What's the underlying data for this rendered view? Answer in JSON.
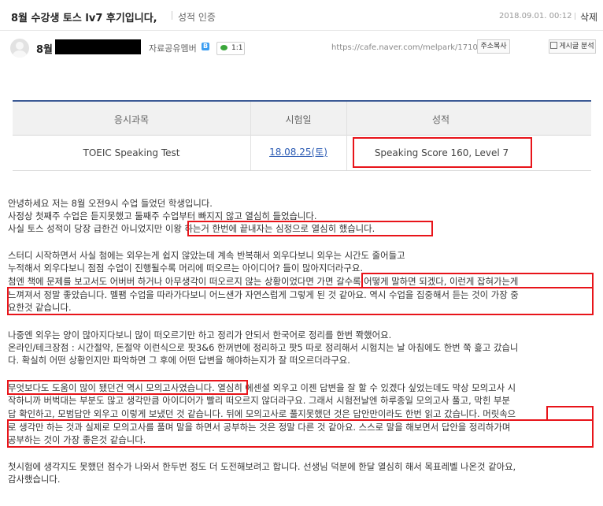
{
  "post": {
    "title": "8월 수강생 토스 lv7 후기입니다,",
    "category": "성적 인증",
    "date": "2018.09.01. 00:12",
    "delete_label": "삭제"
  },
  "author": {
    "name": "8월",
    "level": "자료공유멤버",
    "level_icon": "B",
    "talk_count": "1:1",
    "url": "https://cafe.naver.com/melpark/17109",
    "copy_button": "주소복사",
    "view_button": "게시글 분석"
  },
  "table": {
    "headers": [
      "응시과목",
      "시험일",
      "성적"
    ],
    "row": [
      "TOEIC Speaking Test",
      "18.08.25(토)",
      "Speaking Score 160, Level 7"
    ]
  },
  "body": {
    "lines": [
      "안녕하세요 저는 8월 오전9시 수업 들었던 학생입니다.",
      "사정상 첫째주 수업은 듣지못했고 둘째주 수업부터 빠지지 않고 열심히 들었습니다.",
      "사실 토스 성적이 당장 급한건 아니었지만 이왕 하는거 한번에 끝내자는 심정으로 열심히 했습니다.",
      "스터디 시작하면서 사실 첨에는 외우는게 쉽지 않았는데 계속 반복해서 외우다보니 외우는 시간도 줄어들고",
      "누적해서 외우다보니 점점 수업이 진행될수록 머리에 떠오르는 아이디어? 들이 많아지더라구요.",
      "첨엔 책에 문제를 보고서도 어버버 하거나 아무생각이 떠오르지 않는 상황이었다면 가면 갈수록 어떻게 말하면 되겠다, 이런게 잡혀가는게",
      "느껴져서 정말 좋았습니다. 멜팸 수업을 따라가다보니 어느샌가 자연스럽게 그렇게 된 것 같아요. 역시 수업을 집중해서 듣는 것이 가장 중",
      "요한것 같습니다.",
      "나중엔 외우는 양이 많아지다보니 많이 떠오르기만 하고 정리가 안되서 한국어로 정리를 한번 쫙했어요.",
      "온라인/테크장점 : 시간절약, 돈절약 이런식으로 팟3&6 한꺼번에 정리하고 팟5 따로 정리해서 시험치는 날 아침에도 한번 쭉 흝고 갔습니",
      "다. 확실히 어떤 상황인지만 파악하면 그 후에 어떤 답변을 해야하는지가 잘 떠오르더라구요.",
      "무엇보다도 도움이 많이 됐던건 역시 모의고사였습니다. 열심히 에센셜 외우고 이젠 답변을 잘 할 수 있겠다 싶었는데도 막상 모의고사 시",
      "작하니까 버벅대는 부분도 많고 생각만큼 아이디어가 빨리 떠오르지 않더라구요. 그래서 시험전날엔 하루종일 모의고사 풀고, 막힌 부분",
      "답 확인하고, 모범답안 외우고 이렇게 보냈던 것 같습니다. 뒤에 모의고사로 풀지못했던 것은 답안만이라도 한번 읽고 갔습니다. 머릿속으",
      "로 생각만 하는 것과 실제로 모의고사를 풀며 말을 하면서 공부하는 것은 정말 다른 것 같아요. 스스로 말을 해보면서 답안을 정리하가며",
      "공부하는 것이 가장 좋은것 같습니다.",
      "첫시험에 생각지도 못했던 점수가 나와서 한두번 정도 더 도전해보려고 합니다. 선생님 덕분에 한달 열심히 해서 목표레벨 나온것 같아요,",
      "감사했습니다."
    ]
  },
  "colors": {
    "highlight": "#e8141a",
    "table_accent": "#3b5a95",
    "link": "#2a5ab3"
  }
}
